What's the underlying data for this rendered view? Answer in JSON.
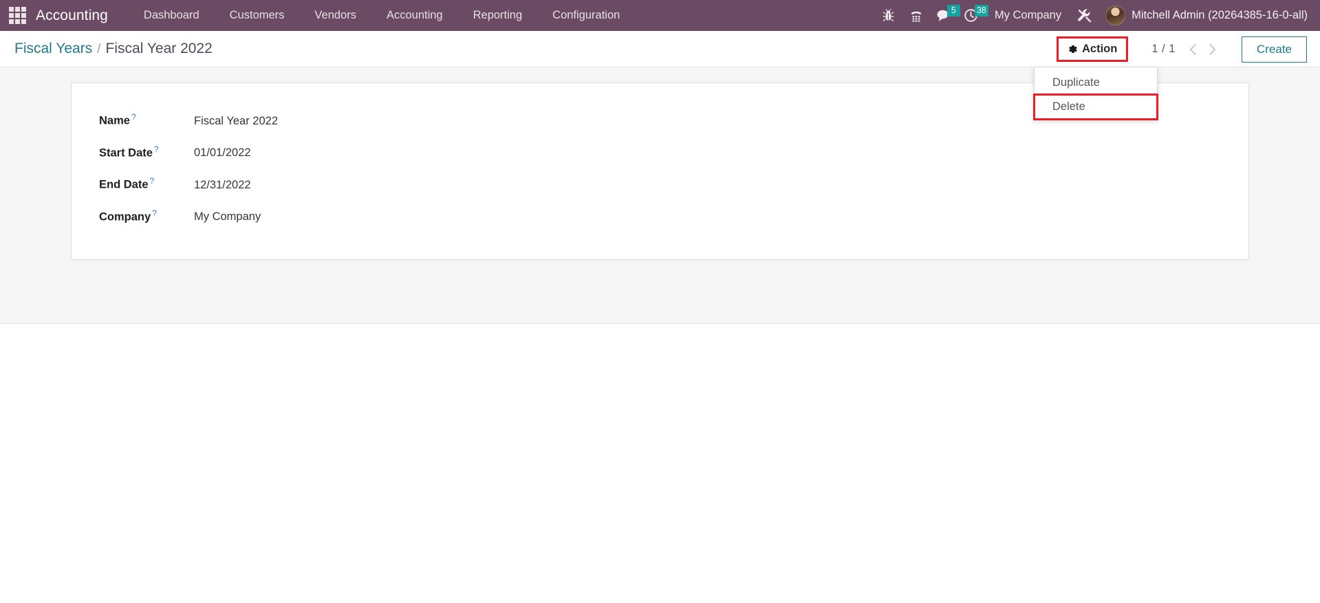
{
  "navbar": {
    "apps_icon": "apps-grid-icon",
    "brand": "Accounting",
    "menu": [
      {
        "label": "Dashboard"
      },
      {
        "label": "Customers"
      },
      {
        "label": "Vendors"
      },
      {
        "label": "Accounting"
      },
      {
        "label": "Reporting"
      },
      {
        "label": "Configuration"
      }
    ],
    "systray": [
      {
        "name": "bug-icon",
        "badge": null
      },
      {
        "name": "phone-keypad-icon",
        "badge": null
      },
      {
        "name": "messages-icon",
        "badge": "5"
      },
      {
        "name": "activities-clock-icon",
        "badge": "38"
      }
    ],
    "company": "My Company",
    "debug_icon": "wrench-debug-icon",
    "user": "Mitchell Admin (20264385-16-0-all)",
    "bg_color": "#6b4b63",
    "badge_color": "#17a2a2"
  },
  "control_panel": {
    "breadcrumb": {
      "parent": "Fiscal Years",
      "separator": "/",
      "current": "Fiscal Year 2022"
    },
    "action_button": {
      "label": "Action",
      "icon": "gear-icon",
      "highlighted": true,
      "highlight_color": "#ee1c25"
    },
    "pager": {
      "count": "1 / 1",
      "prev_icon": "chevron-left-icon",
      "next_icon": "chevron-right-icon"
    },
    "create_label": "Create",
    "create_color": "#1f7a8c"
  },
  "action_dropdown": {
    "visible": true,
    "items": [
      {
        "label": "Duplicate",
        "highlighted": false
      },
      {
        "label": "Delete",
        "highlighted": true
      }
    ]
  },
  "form": {
    "tooltip_marker": "?",
    "fields": [
      {
        "label": "Name",
        "value": "Fiscal Year 2022"
      },
      {
        "label": "Start Date",
        "value": "01/01/2022"
      },
      {
        "label": "End Date",
        "value": "12/31/2022"
      },
      {
        "label": "Company",
        "value": "My Company"
      }
    ]
  }
}
